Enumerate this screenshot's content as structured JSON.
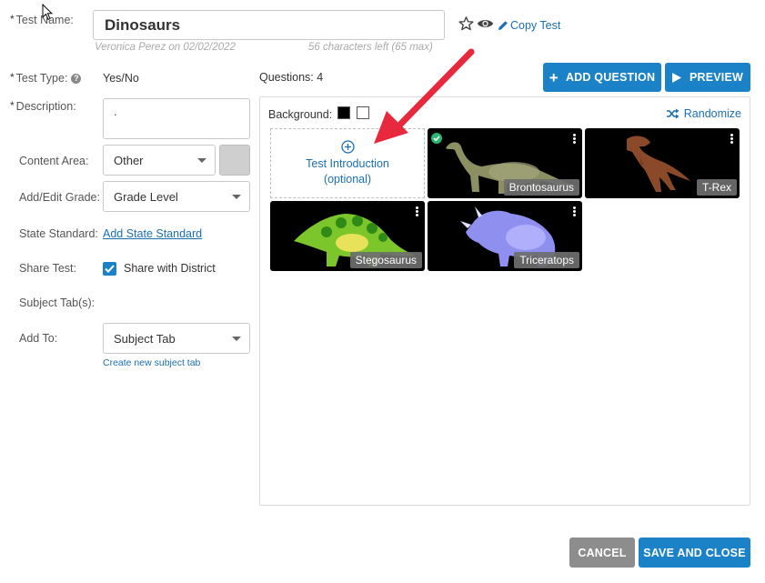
{
  "form": {
    "test_name_label": "Test Name:",
    "test_name_value": "Dinosaurs",
    "author_meta": "Veronica Perez on 02/02/2022",
    "char_count": "56 characters left (65 max)",
    "copy_test": "Copy Test",
    "test_type_label": "Test Type:",
    "test_type_value": "Yes/No",
    "description_label": "Description:",
    "description_value": ".",
    "content_area_label": "Content Area:",
    "content_area_value": "Other",
    "grade_label": "Add/Edit Grade:",
    "grade_value": "Grade Level",
    "state_standard_label": "State Standard:",
    "state_standard_link": "Add State Standard",
    "share_label": "Share Test:",
    "share_checkbox": "Share with District",
    "share_checked": true,
    "subject_tab_label": "Subject Tab(s):",
    "add_to_label": "Add To:",
    "add_to_value": "Subject Tab",
    "create_subject_tab": "Create new subject tab",
    "required_mark": "*"
  },
  "questions": {
    "count_label": "Questions: 4",
    "add_question": "ADD QUESTION",
    "preview": "PREVIEW",
    "background_label": "Background:",
    "randomize": "Randomize",
    "intro_line1": "Test Introduction",
    "intro_line2": "(optional)",
    "tiles": [
      {
        "label": "Brontosaurus",
        "checked": true
      },
      {
        "label": "T-Rex",
        "checked": false
      },
      {
        "label": "Stegosaurus",
        "checked": false
      },
      {
        "label": "Triceratops",
        "checked": false
      }
    ]
  },
  "footer": {
    "cancel": "CANCEL",
    "save_close": "SAVE AND CLOSE"
  },
  "colors": {
    "primary": "#1b82c7",
    "cancel": "#8d8d8d",
    "arrow": "#e8283c",
    "check": "#2bb673"
  }
}
